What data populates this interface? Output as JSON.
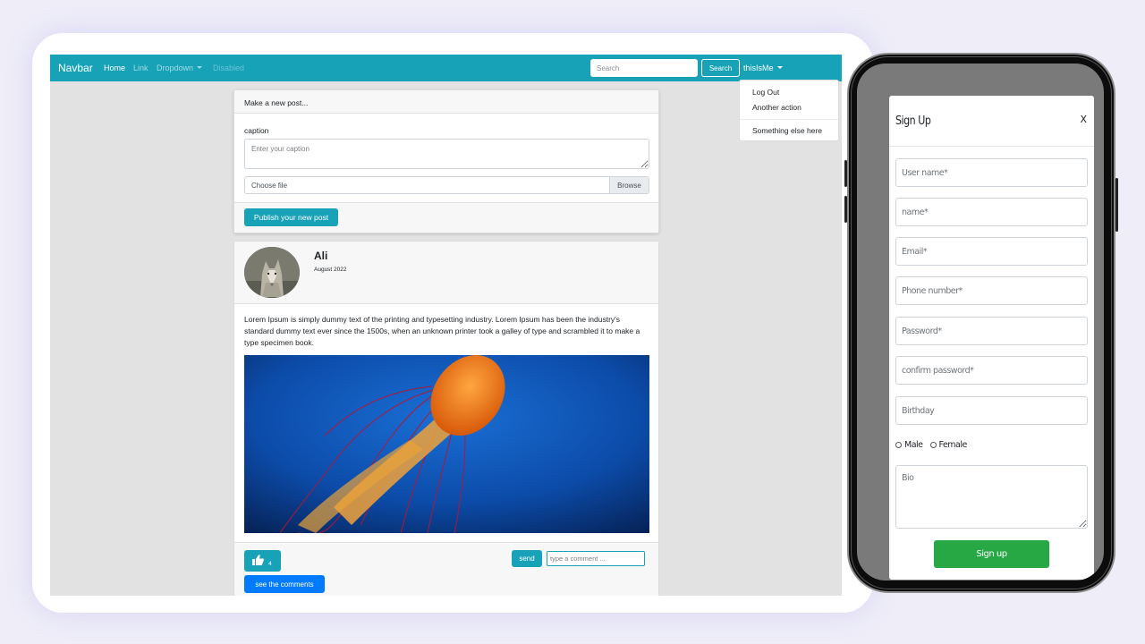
{
  "navbar": {
    "brand": "Navbar",
    "links": [
      "Home",
      "Link",
      "Dropdown",
      "Disabled"
    ],
    "search_placeholder": "Search",
    "search_button": "Search",
    "user": "thisIsMe",
    "dropdown_items": [
      "Log Out",
      "Another action",
      "Something else here"
    ],
    "accent_color": "#17a2b8"
  },
  "new_post": {
    "header": "Make a new post...",
    "caption_label": "caption",
    "caption_placeholder": "Enter your caption",
    "file_label": "Choose file",
    "browse": "Browse",
    "publish": "Publish your new post"
  },
  "post": {
    "author": "Ali",
    "date": "August 2022",
    "text": "Lorem Ipsum is simply dummy text of the printing and typesetting industry. Lorem Ipsum has been the industry's standard dummy text ever since the 1500s, when an unknown printer took a galley of type and scrambled it to make a type specimen book.",
    "likes": "4",
    "send": "send",
    "comment_placeholder": "type a comment ...",
    "see_comments": "see the comments"
  },
  "signup": {
    "title": "Sign Up",
    "close": "X",
    "fields": [
      "User name*",
      "name*",
      "Email*",
      "Phone number*",
      "Password*",
      "confirm password*",
      "Birthday"
    ],
    "gender_options": [
      "Male",
      "Female"
    ],
    "bio_placeholder": "Bio",
    "submit": "Sign up",
    "submit_color": "#28a745"
  }
}
